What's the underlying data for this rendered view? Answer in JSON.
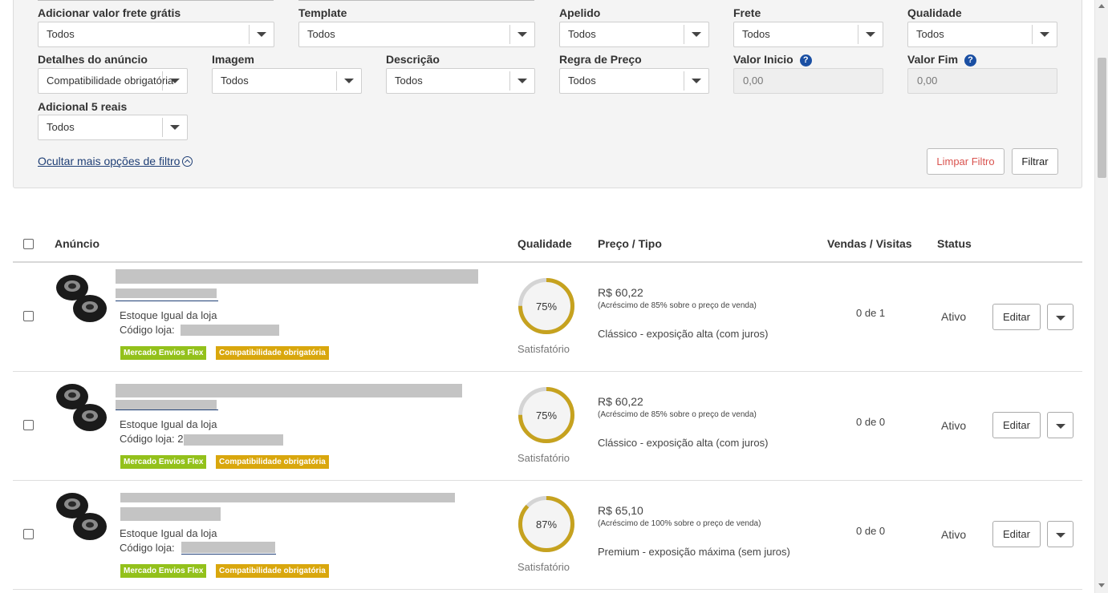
{
  "filters": {
    "frete_gratis": {
      "label": "Adicionar valor frete grátis",
      "value": "Todos"
    },
    "template": {
      "label": "Template",
      "value": "Todos"
    },
    "apelido": {
      "label": "Apelido",
      "value": "Todos"
    },
    "frete": {
      "label": "Frete",
      "value": "Todos"
    },
    "qualidade": {
      "label": "Qualidade",
      "value": "Todos"
    },
    "detalhes": {
      "label": "Detalhes do anúncio",
      "value": "Compatibilidade obrigatória"
    },
    "imagem": {
      "label": "Imagem",
      "value": "Todos"
    },
    "descricao": {
      "label": "Descrição",
      "value": "Todos"
    },
    "regra_preco": {
      "label": "Regra de Preço",
      "value": "Todos"
    },
    "valor_inicio": {
      "label": "Valor Inicio",
      "placeholder": "0,00"
    },
    "valor_fim": {
      "label": "Valor Fim",
      "placeholder": "0,00"
    },
    "adicional": {
      "label": "Adicional 5 reais",
      "value": "Todos"
    },
    "help_glyph": "?",
    "toggle_label": "Ocultar mais opções de filtro",
    "clear_label": "Limpar Filtro",
    "filter_label": "Filtrar"
  },
  "colors": {
    "accent_blue": "#1a4fa3",
    "clear_red": "#d9534f",
    "gauge_gold": "#c6a21f",
    "badge_green": "#93c11b",
    "badge_yellow": "#d9a70d"
  },
  "table": {
    "headers": {
      "listing": "Anúncio",
      "quality": "Qualidade",
      "price_type": "Preço / Tipo",
      "sales_visits": "Vendas / Visitas",
      "status": "Status"
    },
    "rows": [
      {
        "stock": "Estoque Igual da loja",
        "store_code_label": "Código loja:",
        "badge1": "Mercado Envios Flex",
        "badge2": "Compatibilidade obrigatória",
        "quality_pct": 75,
        "quality_value": "75%",
        "quality_label": "Satisfatório",
        "price": "R$ 60,22",
        "price_note": "(Acréscimo de 85% sobre o preço de venda)",
        "listing_type": "Clássico - exposição alta (com juros)",
        "sales": "0 de 1",
        "status": "Ativo",
        "edit_label": "Editar"
      },
      {
        "stock": "Estoque Igual da loja",
        "store_code_label": "Código loja: 2",
        "badge1": "Mercado Envios Flex",
        "badge2": "Compatibilidade obrigatória",
        "quality_pct": 75,
        "quality_value": "75%",
        "quality_label": "Satisfatório",
        "price": "R$ 60,22",
        "price_note": "(Acréscimo de 85% sobre o preço de venda)",
        "listing_type": "Clássico - exposição alta (com juros)",
        "sales": "0 de 0",
        "status": "Ativo",
        "edit_label": "Editar"
      },
      {
        "stock": "Estoque Igual da loja",
        "store_code_label": "Código loja:",
        "badge1": "Mercado Envios Flex",
        "badge2": "Compatibilidade obrigatória",
        "quality_pct": 87,
        "quality_value": "87%",
        "quality_label": "Satisfatório",
        "price": "R$ 65,10",
        "price_note": "(Acréscimo de 100% sobre o preço de venda)",
        "listing_type": "Premium - exposição máxima (sem juros)",
        "sales": "0 de 0",
        "status": "Ativo",
        "edit_label": "Editar"
      }
    ]
  }
}
